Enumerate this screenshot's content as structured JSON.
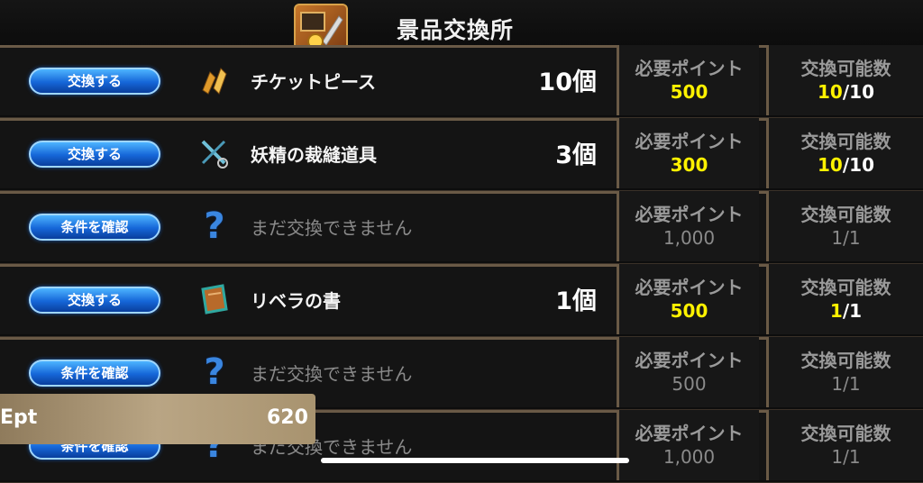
{
  "header": {
    "title": "景品交換所",
    "icon": "exchange-shop-icon"
  },
  "labels": {
    "points": "必要ポイント",
    "avail": "交換可能数"
  },
  "rows": [
    {
      "button": "交換する",
      "icon": "ticket-piece-icon",
      "name": "チケットピース",
      "qty": "10個",
      "points": "500",
      "avail_have": "10",
      "avail_sep": "/",
      "avail_max": "10",
      "locked": false
    },
    {
      "button": "交換する",
      "icon": "fairy-sewing-tool-icon",
      "name": "妖精の裁縫道具",
      "qty": "3個",
      "points": "300",
      "avail_have": "10",
      "avail_sep": "/",
      "avail_max": "10",
      "locked": false
    },
    {
      "button": "条件を確認",
      "icon": "question-icon",
      "name": "まだ交換できません",
      "qty": "",
      "points": "1,000",
      "avail_have": "1",
      "avail_sep": "/",
      "avail_max": "1",
      "locked": true
    },
    {
      "button": "交換する",
      "icon": "book-icon",
      "name": "リベラの書",
      "qty": "1個",
      "points": "500",
      "avail_have": "1",
      "avail_sep": "/",
      "avail_max": "1",
      "locked": false
    },
    {
      "button": "条件を確認",
      "icon": "question-icon",
      "name": "まだ交換できません",
      "qty": "",
      "points": "500",
      "avail_have": "1",
      "avail_sep": "/",
      "avail_max": "1",
      "locked": true
    },
    {
      "button": "条件を確認",
      "icon": "question-icon",
      "name": "まだ交換できません",
      "qty": "",
      "points": "1,000",
      "avail_have": "1",
      "avail_sep": "/",
      "avail_max": "1",
      "locked": true
    }
  ],
  "points_panel": {
    "label": "Ept",
    "value": "620"
  }
}
